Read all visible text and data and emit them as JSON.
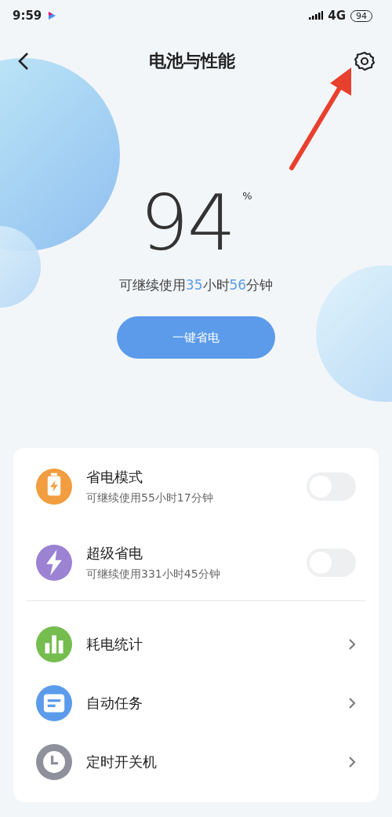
{
  "status_bar": {
    "time": "9:59",
    "network": "4G",
    "battery": "94"
  },
  "header": {
    "title": "电池与性能"
  },
  "battery": {
    "percent": "94",
    "unit": "%",
    "remaining": [
      {
        "text": "可继续使用",
        "highlight": false
      },
      {
        "text": "35",
        "highlight": true
      },
      {
        "text": "小时",
        "highlight": false
      },
      {
        "text": "56",
        "highlight": true
      },
      {
        "text": "分钟",
        "highlight": false
      }
    ]
  },
  "save_button": "一键省电",
  "modes": [
    {
      "kind": "battery",
      "title": "省电模式",
      "subtitle": "可继续使用55小时17分钟",
      "on": false,
      "color": "#f29d3f"
    },
    {
      "kind": "bolt",
      "title": "超级省电",
      "subtitle": "可继续使用331小时45分钟",
      "on": false,
      "color": "#9b82d2"
    }
  ],
  "tools": [
    {
      "kind": "chart",
      "title": "耗电统计",
      "color": "#75bd4f"
    },
    {
      "kind": "note",
      "title": "自动任务",
      "color": "#5b9bea"
    },
    {
      "kind": "clock",
      "title": "定时开关机",
      "color": "#8e919c"
    }
  ]
}
